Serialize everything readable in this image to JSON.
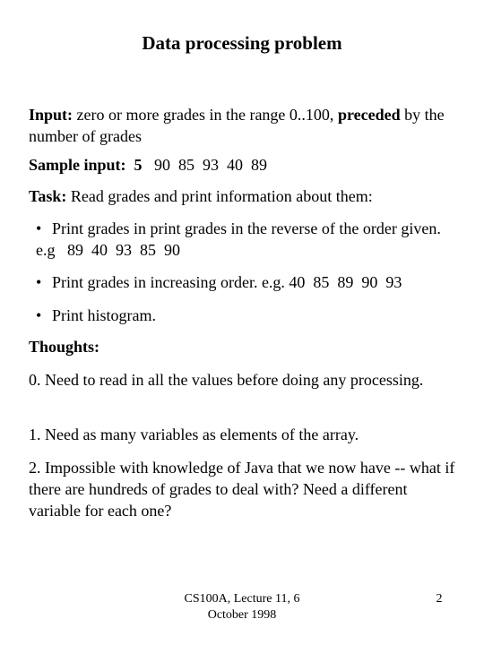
{
  "slide": {
    "title": "Data processing problem",
    "input": {
      "label": "Input:",
      "text": " zero or more grades in the range 0..100, ",
      "emph": "preceded",
      "text2": " by the number of grades"
    },
    "sample": {
      "label": "Sample input:  5",
      "values": "   90  85  93  40  89"
    },
    "task": {
      "label": "Task:",
      "text": " Read grades and print information about them:"
    },
    "bullets": [
      {
        "glyph": "•",
        "text": "Print grades in print grades in the reverse of the order given. e.g   89  40  93  85  90"
      },
      {
        "glyph": "•",
        "text": "Print grades in increasing order. e.g. 40  85  89  90  93"
      },
      {
        "glyph": "•",
        "text": "Print histogram."
      }
    ],
    "thoughts_label": "Thoughts:",
    "thoughts": [
      "0.  Need to read in all the values before doing any processing.",
      "1. Need as many variables as elements of the array.",
      "2. Impossible with knowledge of Java that we now have -- what if there are hundreds of grades to deal with? Need a different variable for each one?"
    ]
  },
  "footer": {
    "course_line1": "CS100A, Lecture 11, 6",
    "course_line2": "October 1998",
    "page_number": "2"
  }
}
